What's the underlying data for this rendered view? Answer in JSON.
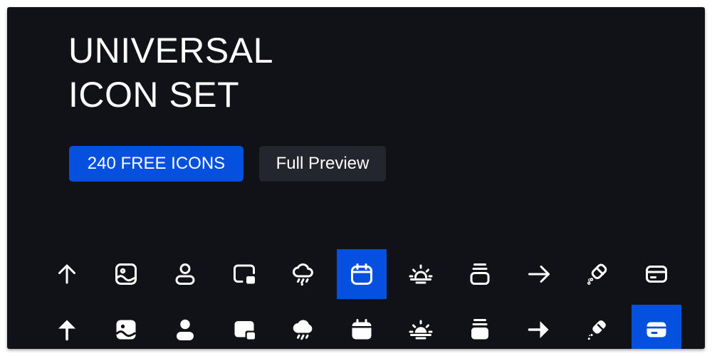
{
  "hero": {
    "title_line1": "UNIVERSAL",
    "title_line2": "ICON SET"
  },
  "buttons": {
    "primary_label": "240 FREE ICONS",
    "secondary_label": "Full Preview"
  },
  "colors": {
    "background": "#111217",
    "accent": "#0650e0",
    "secondary_button": "#24262e",
    "icon": "#ffffff"
  },
  "icons": {
    "outline_row": [
      "arrow-up",
      "image",
      "user",
      "picture-in-picture",
      "cloud-rain",
      "calendar",
      "sunrise",
      "stack",
      "arrow-right",
      "eraser",
      "credit-card"
    ],
    "solid_row": [
      "arrow-up",
      "image",
      "user",
      "picture-in-picture",
      "cloud-rain",
      "calendar",
      "sunrise",
      "stack",
      "arrow-right",
      "eraser",
      "credit-card"
    ],
    "highlighted": {
      "outline_row": "calendar",
      "solid_row": "credit-card"
    }
  }
}
